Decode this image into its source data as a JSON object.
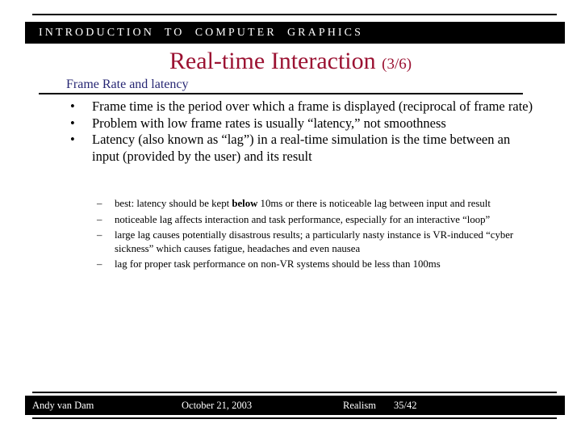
{
  "header": {
    "course_title": "INTRODUCTION  TO  COMPUTER  GRAPHICS"
  },
  "title": {
    "text": "Real-time Interaction",
    "slide_count": "(3/6)",
    "color": "#9B1232"
  },
  "subheading": {
    "text": "Frame Rate and latency",
    "color": "#262673"
  },
  "bullets": [
    {
      "marker": "•",
      "text": "Frame time is the period over which a frame is displayed (reciprocal of frame rate)"
    },
    {
      "marker": "•",
      "text": "Problem with low frame rates is usually “latency,” not smoothness"
    },
    {
      "marker": "•",
      "text": "Latency (also known as “lag”) in a real-time simulation is the time between an input (provided by the user) and its result"
    }
  ],
  "sub_bullets": [
    {
      "marker": "–",
      "pre": "best: latency should be kept ",
      "bold": "below",
      "post": " 10ms or there is noticeable lag between input and result"
    },
    {
      "marker": "–",
      "pre": "noticeable lag affects interaction and task performance, especially for an interactive “loop”",
      "bold": "",
      "post": ""
    },
    {
      "marker": "–",
      "pre": "large lag causes potentially disastrous results; a particularly nasty instance is VR-induced “cyber sickness” which causes fatigue, headaches and even nausea",
      "bold": "",
      "post": ""
    },
    {
      "marker": "–",
      "pre": "lag for proper task performance on non-VR systems should be less than 100ms",
      "bold": "",
      "post": ""
    }
  ],
  "footer": {
    "author": "Andy van Dam",
    "date": "October 21, 2003",
    "topic": "Realism",
    "page": "35/42"
  }
}
